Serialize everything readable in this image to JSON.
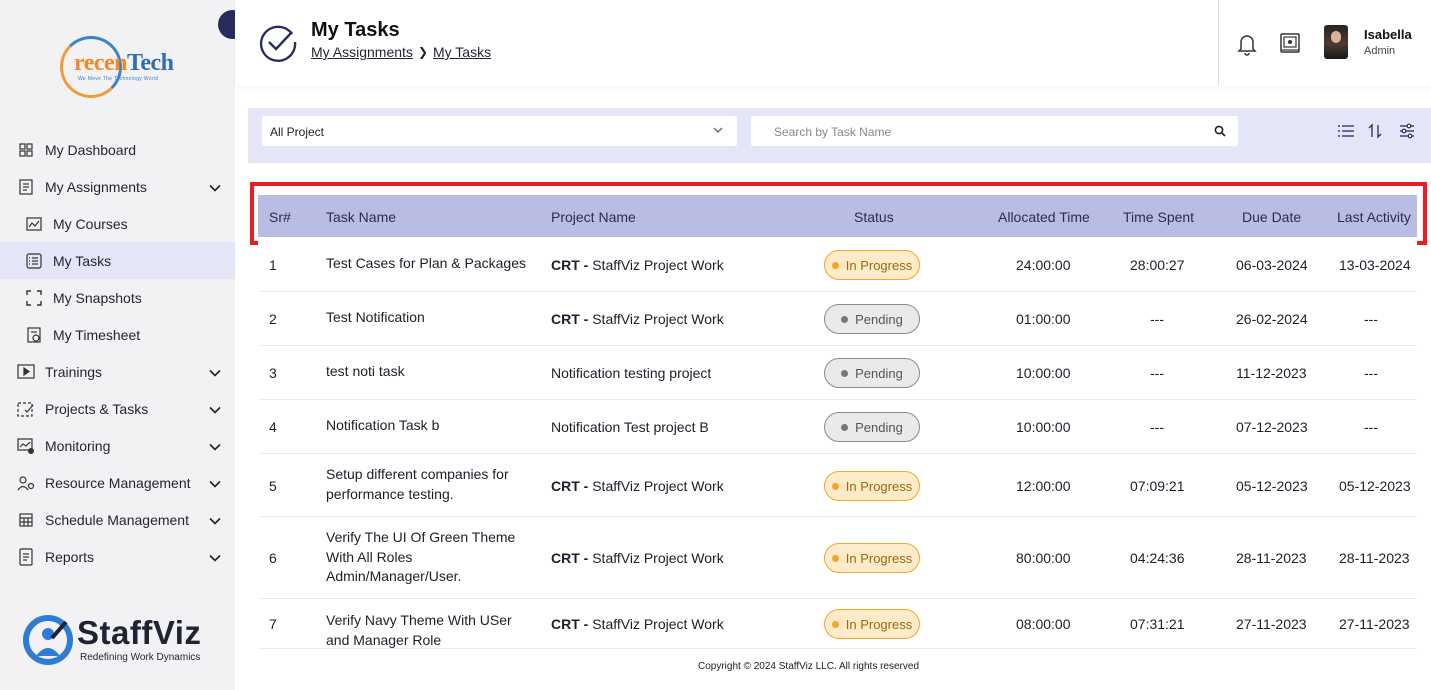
{
  "brand": {
    "logo_text_a": "recen",
    "logo_text_b": "Tech",
    "logo_tagline": "We Move The Technology World",
    "footer_logo_name": "StaffViz",
    "footer_logo_tagline": "Redefining Work Dynamics"
  },
  "sidebar": {
    "items": [
      {
        "label": "My Dashboard",
        "icon": "dashboard-icon"
      },
      {
        "label": "My Assignments",
        "icon": "assignments-icon",
        "expandable": true
      },
      {
        "label": "My Courses",
        "icon": "courses-icon",
        "sub": true
      },
      {
        "label": "My Tasks",
        "icon": "tasks-icon",
        "sub": true,
        "active": true
      },
      {
        "label": "My Snapshots",
        "icon": "snapshot-icon",
        "sub": true
      },
      {
        "label": "My Timesheet",
        "icon": "timesheet-icon",
        "sub": true
      },
      {
        "label": "Trainings",
        "icon": "trainings-icon",
        "expandable": true
      },
      {
        "label": "Projects & Tasks",
        "icon": "projects-icon",
        "expandable": true
      },
      {
        "label": "Monitoring",
        "icon": "monitoring-icon",
        "expandable": true
      },
      {
        "label": "Resource Management",
        "icon": "resource-icon",
        "expandable": true
      },
      {
        "label": "Schedule Management",
        "icon": "schedule-icon",
        "expandable": true
      },
      {
        "label": "Reports",
        "icon": "reports-icon",
        "expandable": true
      }
    ]
  },
  "header": {
    "title": "My Tasks",
    "breadcrumb": [
      "My Assignments",
      "My Tasks"
    ],
    "user_name": "Isabella",
    "user_role": "Admin"
  },
  "filters": {
    "project_select": "All Project",
    "search_placeholder": "Search by Task Name"
  },
  "table": {
    "columns": [
      "Sr#",
      "Task Name",
      "Project Name",
      "Status",
      "Allocated Time",
      "Time Spent",
      "Due Date",
      "Last Activity"
    ],
    "rows": [
      {
        "sr": "1",
        "task": "Test Cases for Plan & Packages",
        "project_prefix": "CRT -",
        "project": "StaffViz Project Work",
        "status": "In Progress",
        "alloc": "24:00:00",
        "spent": "28:00:27",
        "due": "06-03-2024",
        "last": "13-03-2024"
      },
      {
        "sr": "2",
        "task": "Test Notification",
        "project_prefix": "CRT -",
        "project": "StaffViz Project Work",
        "status": "Pending",
        "alloc": "01:00:00",
        "spent": "---",
        "due": "26-02-2024",
        "last": "---"
      },
      {
        "sr": "3",
        "task": "test noti task",
        "project_prefix": "",
        "project": "Notification testing project",
        "status": "Pending",
        "alloc": "10:00:00",
        "spent": "---",
        "due": "11-12-2023",
        "last": "---"
      },
      {
        "sr": "4",
        "task": "Notification Task b",
        "project_prefix": "",
        "project": "Notification Test project B",
        "status": "Pending",
        "alloc": "10:00:00",
        "spent": "---",
        "due": "07-12-2023",
        "last": "---"
      },
      {
        "sr": "5",
        "task": "Setup different companies for performance testing.",
        "project_prefix": "CRT -",
        "project": "StaffViz Project Work",
        "status": "In Progress",
        "alloc": "12:00:00",
        "spent": "07:09:21",
        "due": "05-12-2023",
        "last": "05-12-2023"
      },
      {
        "sr": "6",
        "task": "Verify The UI Of Green Theme With All Roles Admin/Manager/User.",
        "project_prefix": "CRT -",
        "project": "StaffViz Project Work",
        "status": "In Progress",
        "alloc": "80:00:00",
        "spent": "04:24:36",
        "due": "28-11-2023",
        "last": "28-11-2023"
      },
      {
        "sr": "7",
        "task": "Verify Navy Theme With USer and Manager Role",
        "project_prefix": "CRT -",
        "project": "StaffViz Project Work",
        "status": "In Progress",
        "alloc": "08:00:00",
        "spent": "07:31:21",
        "due": "27-11-2023",
        "last": "27-11-2023"
      }
    ]
  },
  "footer": {
    "copyright": "Copyright © 2024 StaffViz LLC. All rights reserved"
  },
  "colors": {
    "accent": "#272b5e",
    "header_row": "#b9bde3",
    "filter_bar": "#e4e5f6",
    "highlight": "#ec1c24",
    "in_progress": "#f5a623",
    "pending": "#8a8a8a"
  }
}
